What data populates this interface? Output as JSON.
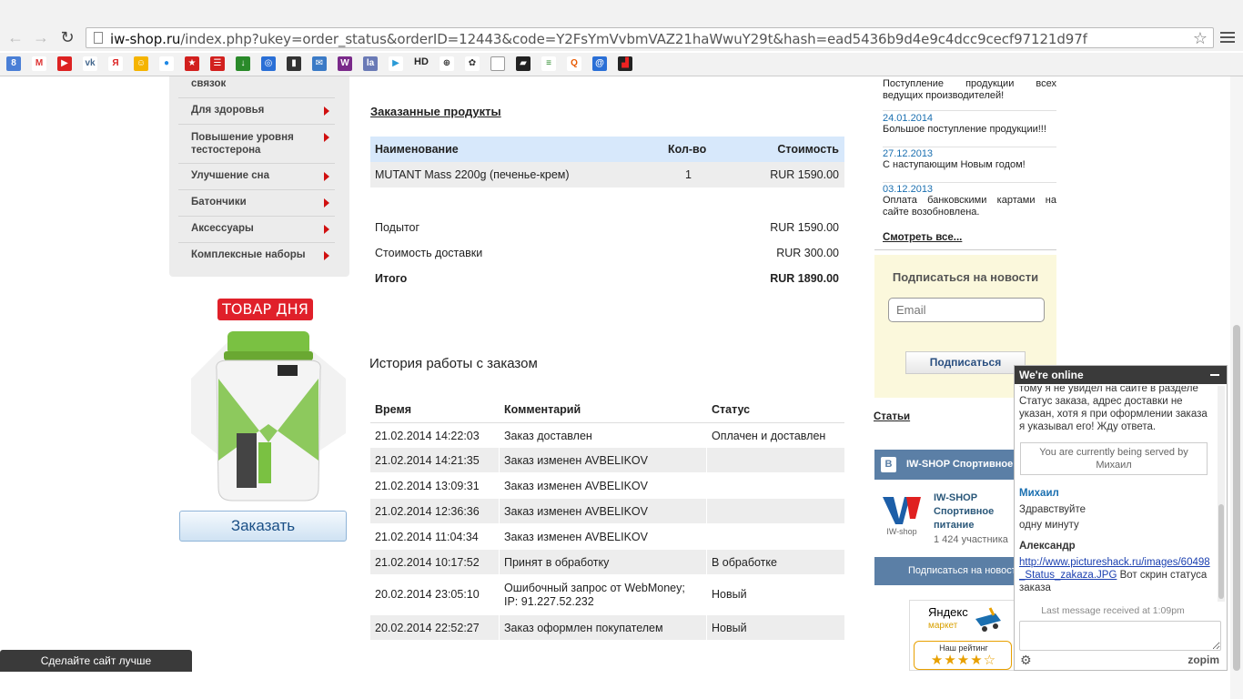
{
  "browser": {
    "url_host": "iw-shop.ru",
    "url_rest": "/index.php?ukey=order_status&orderID=12443&code=Y2FsYmVvbmVAZ21haWwuY29t&hash=ead5436b9d4e9c4dcc9cecf97121d97f",
    "bookmark_hd": "HD"
  },
  "sidebar": {
    "items": [
      {
        "label": "связок"
      },
      {
        "label": "Для здоровья"
      },
      {
        "label": "Повышение уровня тестостерона"
      },
      {
        "label": "Улучшение сна"
      },
      {
        "label": "Батончики"
      },
      {
        "label": "Аксессуары"
      },
      {
        "label": "Комплексные наборы"
      }
    ]
  },
  "deal": {
    "badge": "ТОВАР ДНЯ",
    "button": "Заказать"
  },
  "order": {
    "products_title": "Заказанные продукты",
    "headers": {
      "name": "Наименование",
      "qty": "Кол-во",
      "cost": "Стоимость"
    },
    "product": {
      "name": "MUTANT Mass 2200g (печенье-крем)",
      "qty": "1",
      "cost": "RUR 1590.00"
    },
    "subtotal_label": "Подытог",
    "subtotal": "RUR 1590.00",
    "shipping_label": "Стоимость доставки",
    "shipping": "RUR 300.00",
    "total_label": "Итого",
    "total": "RUR 1890.00"
  },
  "history": {
    "title": "История работы с заказом",
    "headers": {
      "time": "Время",
      "comment": "Комментарий",
      "status": "Статус"
    },
    "rows": [
      {
        "time": "21.02.2014 14:22:03",
        "comment": "Заказ доставлен",
        "status": "Оплачен и доставлен"
      },
      {
        "time": "21.02.2014 14:21:35",
        "comment": "Заказ изменен AVBELIKOV",
        "status": ""
      },
      {
        "time": "21.02.2014 13:09:31",
        "comment": "Заказ изменен AVBELIKOV",
        "status": ""
      },
      {
        "time": "21.02.2014 12:36:36",
        "comment": "Заказ изменен AVBELIKOV",
        "status": ""
      },
      {
        "time": "21.02.2014 11:04:34",
        "comment": "Заказ изменен AVBELIKOV",
        "status": ""
      },
      {
        "time": "21.02.2014 10:17:52",
        "comment": "Принят в обработку",
        "status": "В обработке"
      },
      {
        "time": "20.02.2014 23:05:10",
        "comment": "Ошибочный запрос от WebMoney;",
        "comment2": "IP: 91.227.52.232",
        "status": "Новый"
      },
      {
        "time": "20.02.2014 22:52:27",
        "comment": "Заказ оформлен покупателем",
        "status": "Новый"
      }
    ]
  },
  "news": {
    "first_text": "Поступление продукции всех ведущих производителей!",
    "items": [
      {
        "date": "24.01.2014",
        "text": "Большое поступление продукции!!!"
      },
      {
        "date": "27.12.2013",
        "text": "С наступающим Новым годом!"
      },
      {
        "date": "03.12.2013",
        "text": "Оплата банковскими картами на сайте возобновлена."
      }
    ],
    "all_link": "Смотреть все..."
  },
  "subscribe": {
    "title": "Подписаться на новости",
    "placeholder": "Email",
    "button": "Подписаться"
  },
  "articles_link": "Статьи",
  "vk": {
    "logo": "В",
    "header": "IW-SHOP Спортивное",
    "group_line1": "IW-SHOP",
    "group_line2": "Спортивное",
    "group_line3": "питание",
    "members": "1 424 участника",
    "avatar_caption": "IW-shop",
    "join": "Подписаться на новост"
  },
  "yandex": {
    "title": "Яндекс",
    "sub": "маркет",
    "rating_label": "Наш рейтинг",
    "stars": "★★★★☆"
  },
  "chat": {
    "header": "We're online",
    "msg_partial": "тому я не увидел на сайте в разделе Статус заказа, адрес доставки не указан, хотя я при оформлении заказа я указывал его! Жду ответа.",
    "served": "You are currently being served by Михаил",
    "agent_name": "Михаил",
    "agent_msg1": "Здравствуйте",
    "agent_msg2": "одну минуту",
    "user_name": "Александр",
    "user_link": "http://www.pictureshack.ru/images/60498_Status_zakaza.JPG",
    "user_msg": " Вот скрин статуса заказа",
    "last": "Last message received at 1:09pm",
    "brand": "zopim"
  },
  "feedback": "Сделайте сайт лучше"
}
